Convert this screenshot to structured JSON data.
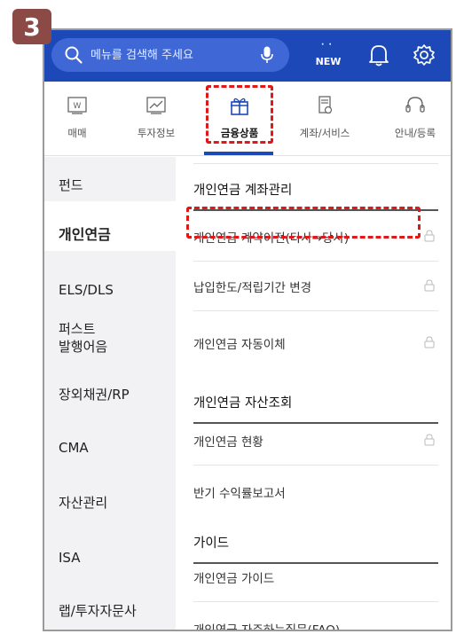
{
  "step_badge": "3",
  "search": {
    "placeholder": "메뉴를 검색해 주세요"
  },
  "header": {
    "new_label": "NEW",
    "new_sparks": "· ·"
  },
  "tabs": [
    {
      "label": "매매",
      "icon": "won-chart-icon",
      "active": false
    },
    {
      "label": "투자정보",
      "icon": "trend-chart-icon",
      "active": false
    },
    {
      "label": "금융상품",
      "icon": "gift-icon",
      "active": true
    },
    {
      "label": "계좌/서비스",
      "icon": "document-icon",
      "active": false
    },
    {
      "label": "안내/등록",
      "icon": "headset-icon",
      "active": false
    }
  ],
  "sidebar": {
    "items": [
      {
        "label": "펀드"
      },
      {
        "label": "개인연금"
      },
      {
        "label": "ELS/DLS"
      },
      {
        "label": "퍼스트\n발행어음"
      },
      {
        "label": "장외채권/RP"
      },
      {
        "label": "CMA"
      },
      {
        "label": "자산관리"
      },
      {
        "label": "ISA"
      },
      {
        "label": "랩/투자자문사"
      }
    ],
    "active_index": 1
  },
  "panel": {
    "sections": [
      {
        "title": "개인연금 계좌관리",
        "items": [
          {
            "label": "개인연금 계약이전(타사→당사)",
            "locked": true
          },
          {
            "label": "납입한도/적립기간 변경",
            "locked": true
          },
          {
            "label": "개인연금 자동이체",
            "locked": true
          }
        ]
      },
      {
        "title": "개인연금 자산조회",
        "items": [
          {
            "label": "개인연금 현황",
            "locked": true
          },
          {
            "label": "반기 수익률보고서",
            "locked": false
          }
        ]
      },
      {
        "title": "가이드",
        "items": [
          {
            "label": "개인연금 가이드",
            "locked": false
          },
          {
            "label": "개인연금 자주하는질문(FAQ)",
            "locked": false
          }
        ]
      }
    ]
  },
  "colors": {
    "brand_blue": "#1d49b8",
    "search_bg": "#3f68d6",
    "highlight_red": "#e01818",
    "badge_brown": "#8b4a45",
    "sidebar_bg": "#f2f2f4"
  }
}
